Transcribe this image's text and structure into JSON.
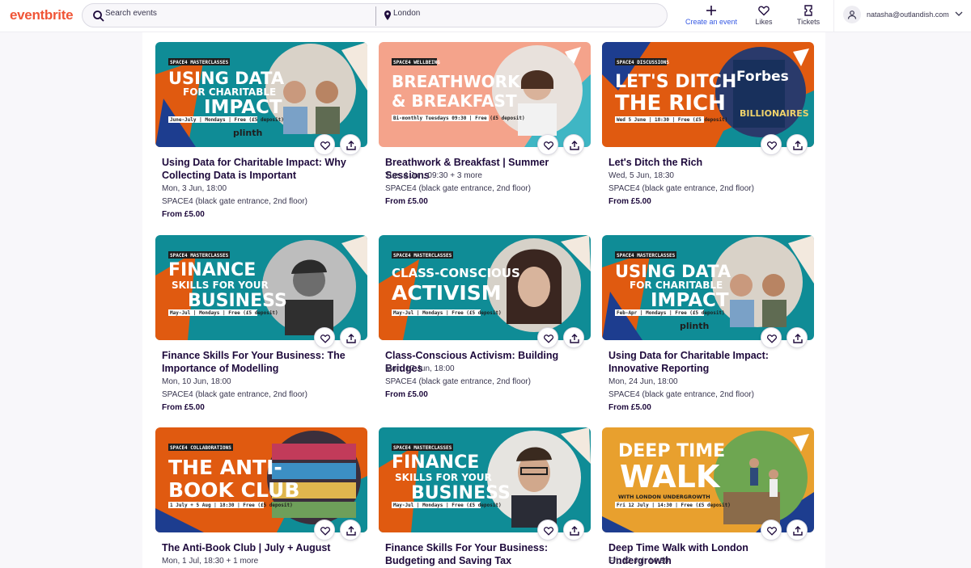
{
  "header": {
    "logo": "eventbrite",
    "search_placeholder": "Search events",
    "location_value": "London",
    "create_label": "Create an event",
    "likes_label": "Likes",
    "tickets_label": "Tickets",
    "user_email": "natasha@outlandish.com"
  },
  "colors": {
    "brand": "#f05537",
    "accent": "#3659e3",
    "teal": "#0f8c96",
    "orange": "#e05a10",
    "peach": "#f4a38b",
    "mustard": "#e8a02e",
    "dark_text": "#1e0a3c"
  },
  "events": [
    {
      "title": "Using Data for Charitable Impact: Why Collecting Data is Important",
      "date": "Mon, 3 Jun, 18:00",
      "venue": "SPACE4 (black gate entrance, 2nd floor)",
      "price": "From £5.00",
      "banner": {
        "tag": "SPACE4 MASTERCLASSES",
        "line1": "USING DATA",
        "line2": "FOR CHARITABLE",
        "line3": "IMPACT",
        "strip": "June-July | Mondays | Free (£5 deposit)",
        "partner": "plinth"
      }
    },
    {
      "title": "Breathwork & Breakfast | Summer Sessions",
      "date": "Tue, 4 Jun, 09:30 + 3 more",
      "venue": "SPACE4 (black gate entrance, 2nd floor)",
      "price": "From £5.00",
      "banner": {
        "tag": "SPACE4 WELLBEING",
        "line1": "BREATHWORK",
        "line2": "& BREAKFAST",
        "line3": "",
        "strip": "Bi-monthly Tuesdays 09:30 | Free (£5 deposit)",
        "partner": ""
      }
    },
    {
      "title": "Let's Ditch the Rich",
      "date": "Wed, 5 Jun, 18:30",
      "venue": "SPACE4 (black gate entrance, 2nd floor)",
      "price": "From £5.00",
      "banner": {
        "tag": "SPACE4 DISCUSSIONS",
        "line1": "LET'S DITCH",
        "line2": "THE RICH",
        "line3": "",
        "strip": "Wed 5 June | 18:30 | Free (£5 deposit)",
        "partner": ""
      }
    },
    {
      "title": "Finance Skills For Your Business: The Importance of Modelling",
      "date": "Mon, 10 Jun, 18:00",
      "venue": "SPACE4 (black gate entrance, 2nd floor)",
      "price": "From £5.00",
      "banner": {
        "tag": "SPACE4 MASTERCLASSES",
        "line1": "FINANCE",
        "line2": "SKILLS FOR YOUR",
        "line3": "BUSINESS",
        "strip": "May-Jul | Mondays | Free (£5 deposit)",
        "partner": ""
      }
    },
    {
      "title": "Class-Conscious Activism: Building Bridges",
      "date": "Mon, 17 Jun, 18:00",
      "venue": "SPACE4 (black gate entrance, 2nd floor)",
      "price": "From £5.00",
      "banner": {
        "tag": "SPACE4 MASTERCLASSES",
        "line1": "CLASS-CONSCIOUS",
        "line2": "ACTIVISM",
        "line3": "",
        "strip": "May-Jul | Mondays | Free (£5 deposit)",
        "partner": ""
      }
    },
    {
      "title": "Using Data for Charitable Impact: Innovative Reporting",
      "date": "Mon, 24 Jun, 18:00",
      "venue": "SPACE4 (black gate entrance, 2nd floor)",
      "price": "From £5.00",
      "banner": {
        "tag": "SPACE4 MASTERCLASSES",
        "line1": "USING DATA",
        "line2": "FOR CHARITABLE",
        "line3": "IMPACT",
        "strip": "Feb-Apr | Mondays | Free (£5 deposit)",
        "partner": "plinth"
      }
    },
    {
      "title": "The Anti-Book Club | July + August",
      "date": "Mon, 1 Jul, 18:30 + 1 more",
      "venue": "",
      "price": "",
      "banner": {
        "tag": "SPACE4 COLLABORATIONS",
        "line1": "THE ANTI-",
        "line2": "BOOK CLUB",
        "line3": "",
        "strip": "1 July + 5 Aug | 18:30 | Free (£5 deposit)",
        "partner": ""
      }
    },
    {
      "title": "Finance Skills For Your Business: Budgeting and Saving Tax",
      "date": "",
      "venue": "",
      "price": "",
      "banner": {
        "tag": "SPACE4 MASTERCLASSES",
        "line1": "FINANCE",
        "line2": "SKILLS FOR YOUR",
        "line3": "BUSINESS",
        "strip": "May-Jul | Mondays | Free (£5 deposit)",
        "partner": ""
      }
    },
    {
      "title": "Deep Time Walk with London Undergrowth",
      "date": "Fri, 12 Jul, 14:30",
      "venue": "",
      "price": "",
      "banner": {
        "tag": "",
        "line1": "DEEP TIME",
        "line2": "WALK",
        "line3": "WITH LONDON UNDERGROWTH",
        "strip": "Fri 12 July | 14:30 | Free (£5 deposit)",
        "partner": ""
      }
    }
  ]
}
